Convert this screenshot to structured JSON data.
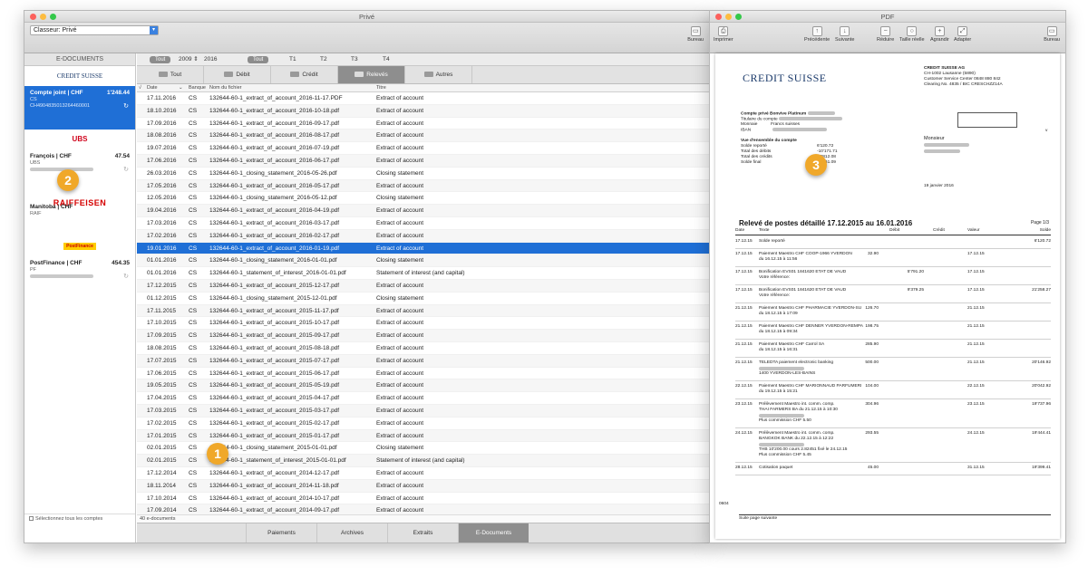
{
  "main_window": {
    "title": "Privé",
    "classeur_select": "Classeur: Privé",
    "bureau_label": "Bureau",
    "sidebar": {
      "header": "E-DOCUMENTS",
      "select_all_label": "Sélectionnez tous les comptes",
      "accounts": [
        {
          "bank_logo": "CREDIT SUISSE",
          "name": "Compte joint | CHF",
          "balance": "1'248.44",
          "bank": "CS",
          "iban": "CH4904835013264460001",
          "selected": true
        },
        {
          "bank_logo": "UBS",
          "name": "François | CHF",
          "balance": "47.54",
          "bank": "UBS",
          "iban": "",
          "selected": false
        },
        {
          "bank_logo": "RAIFFEISEN",
          "name": "Manitoba | CHF",
          "balance": "",
          "bank": "RAIF",
          "iban": "",
          "selected": false
        },
        {
          "bank_logo": "PostFinance",
          "name": "PostFinance | CHF",
          "balance": "454.35",
          "bank": "PF",
          "iban": "",
          "selected": false
        }
      ]
    },
    "filter": {
      "tout1": "Tout",
      "year_from": "2009",
      "year_to": "2016",
      "tout2": "Tout",
      "quarters": [
        "T1",
        "T2",
        "T3",
        "T4"
      ]
    },
    "tabs": [
      "Tout",
      "Débit",
      "Crédit",
      "Relevés",
      "Autres"
    ],
    "active_tab": 3,
    "columns": {
      "date": "Date",
      "bank": "Banque",
      "file": "Nom du fichier",
      "title": "Titre"
    },
    "rows": [
      {
        "date": "17.11.2016",
        "bank": "CS",
        "file": "132644-60-1_extract_of_account_2016-11-17.PDF",
        "title": "Extract of account"
      },
      {
        "date": "18.10.2016",
        "bank": "CS",
        "file": "132644-60-1_extract_of_account_2016-10-18.pdf",
        "title": "Extract of account"
      },
      {
        "date": "17.09.2016",
        "bank": "CS",
        "file": "132644-60-1_extract_of_account_2016-09-17.pdf",
        "title": "Extract of account"
      },
      {
        "date": "18.08.2016",
        "bank": "CS",
        "file": "132644-60-1_extract_of_account_2016-08-17.pdf",
        "title": "Extract of account"
      },
      {
        "date": "19.07.2016",
        "bank": "CS",
        "file": "132644-60-1_extract_of_account_2016-07-19.pdf",
        "title": "Extract of account"
      },
      {
        "date": "17.06.2016",
        "bank": "CS",
        "file": "132644-60-1_extract_of_account_2016-06-17.pdf",
        "title": "Extract of account"
      },
      {
        "date": "26.03.2016",
        "bank": "CS",
        "file": "132644-60-1_closing_statement_2016-05-26.pdf",
        "title": "Closing statement"
      },
      {
        "date": "17.05.2016",
        "bank": "CS",
        "file": "132644-60-1_extract_of_account_2016-05-17.pdf",
        "title": "Extract of account"
      },
      {
        "date": "12.05.2016",
        "bank": "CS",
        "file": "132644-60-1_closing_statement_2016-05-12.pdf",
        "title": "Closing statement"
      },
      {
        "date": "19.04.2016",
        "bank": "CS",
        "file": "132644-60-1_extract_of_account_2016-04-19.pdf",
        "title": "Extract of account"
      },
      {
        "date": "17.03.2016",
        "bank": "CS",
        "file": "132644-60-1_extract_of_account_2016-03-17.pdf",
        "title": "Extract of account"
      },
      {
        "date": "17.02.2016",
        "bank": "CS",
        "file": "132644-60-1_extract_of_account_2016-02-17.pdf",
        "title": "Extract of account"
      },
      {
        "date": "19.01.2016",
        "bank": "CS",
        "file": "132644-60-1_extract_of_account_2016-01-19.pdf",
        "title": "Extract of account",
        "selected": true
      },
      {
        "date": "01.01.2016",
        "bank": "CS",
        "file": "132644-60-1_closing_statement_2016-01-01.pdf",
        "title": "Closing statement"
      },
      {
        "date": "01.01.2016",
        "bank": "CS",
        "file": "132644-60-1_statement_of_interest_2016-01-01.pdf",
        "title": "Statement of interest (and capital)"
      },
      {
        "date": "17.12.2015",
        "bank": "CS",
        "file": "132644-60-1_extract_of_account_2015-12-17.pdf",
        "title": "Extract of account"
      },
      {
        "date": "01.12.2015",
        "bank": "CS",
        "file": "132644-60-1_closing_statement_2015-12-01.pdf",
        "title": "Closing statement"
      },
      {
        "date": "17.11.2015",
        "bank": "CS",
        "file": "132644-60-1_extract_of_account_2015-11-17.pdf",
        "title": "Extract of account"
      },
      {
        "date": "17.10.2015",
        "bank": "CS",
        "file": "132644-60-1_extract_of_account_2015-10-17.pdf",
        "title": "Extract of account"
      },
      {
        "date": "17.09.2015",
        "bank": "CS",
        "file": "132644-60-1_extract_of_account_2015-09-17.pdf",
        "title": "Extract of account"
      },
      {
        "date": "18.08.2015",
        "bank": "CS",
        "file": "132644-60-1_extract_of_account_2015-08-18.pdf",
        "title": "Extract of account"
      },
      {
        "date": "17.07.2015",
        "bank": "CS",
        "file": "132644-60-1_extract_of_account_2015-07-17.pdf",
        "title": "Extract of account"
      },
      {
        "date": "17.06.2015",
        "bank": "CS",
        "file": "132644-60-1_extract_of_account_2015-06-17.pdf",
        "title": "Extract of account"
      },
      {
        "date": "19.05.2015",
        "bank": "CS",
        "file": "132644-60-1_extract_of_account_2015-05-19.pdf",
        "title": "Extract of account"
      },
      {
        "date": "17.04.2015",
        "bank": "CS",
        "file": "132644-60-1_extract_of_account_2015-04-17.pdf",
        "title": "Extract of account"
      },
      {
        "date": "17.03.2015",
        "bank": "CS",
        "file": "132644-60-1_extract_of_account_2015-03-17.pdf",
        "title": "Extract of account"
      },
      {
        "date": "17.02.2015",
        "bank": "CS",
        "file": "132644-60-1_extract_of_account_2015-02-17.pdf",
        "title": "Extract of account"
      },
      {
        "date": "17.01.2015",
        "bank": "CS",
        "file": "132644-60-1_extract_of_account_2015-01-17.pdf",
        "title": "Extract of account"
      },
      {
        "date": "02.01.2015",
        "bank": "CS",
        "file": "132644-60-1_closing_statement_2015-01-01.pdf",
        "title": "Closing statement"
      },
      {
        "date": "02.01.2015",
        "bank": "CS",
        "file": "132644-60-1_statement_of_interest_2015-01-01.pdf",
        "title": "Statement of interest (and capital)"
      },
      {
        "date": "17.12.2014",
        "bank": "CS",
        "file": "132644-60-1_extract_of_account_2014-12-17.pdf",
        "title": "Extract of account"
      },
      {
        "date": "18.11.2014",
        "bank": "CS",
        "file": "132644-60-1_extract_of_account_2014-11-18.pdf",
        "title": "Extract of account"
      },
      {
        "date": "17.10.2014",
        "bank": "CS",
        "file": "132644-60-1_extract_of_account_2014-10-17.pdf",
        "title": "Extract of account"
      },
      {
        "date": "17.09.2014",
        "bank": "CS",
        "file": "132644-60-1_extract_of_account_2014-09-17.pdf",
        "title": "Extract of account"
      }
    ],
    "doc_count": "40 e-documents",
    "bottom_tabs": [
      "Paiements",
      "Archives",
      "Extraits",
      "E-Documents"
    ],
    "active_bottom_tab": 3
  },
  "badges": [
    "1",
    "2",
    "3"
  ],
  "pdf_window": {
    "title": "PDF",
    "toolbar": {
      "print": "Imprimer",
      "prev": "Précédente",
      "next": "Suivante",
      "zoom_out": "Réduire",
      "actual_size": "Taille réelle",
      "zoom_in": "Agrandir",
      "fit": "Adapter",
      "bureau": "Bureau"
    },
    "doc": {
      "logo": "CREDIT SUISSE",
      "bank_name": "CREDIT SUISSE AG",
      "bank_addr1": "CH-1002 Lausanne (5890)",
      "bank_addr2": "Customer Service Center 0848 880 842",
      "bank_addr3": "Clearing No. 4835 / BIC CRESCHZZ14A",
      "account_title": "Compte privé Bonvive Platinum",
      "holder_label": "Titulaire du compte",
      "currency_label": "Monnaie",
      "currency_value": "Francs suisses",
      "iban_label": "IBAN",
      "overview_title": "Vue d'ensemble du compte",
      "summary": [
        {
          "label": "Solde reporté",
          "value": "6'120.72"
        },
        {
          "label": "Total des débits",
          "value": "-10'171.71"
        },
        {
          "label": "Total des crédits",
          "value": "14'812.08"
        },
        {
          "label": "Solde final",
          "value": "10'761.09"
        }
      ],
      "salutation": "Monsieur",
      "date": "19 janvier 2016",
      "statement_title": "Relevé de postes détaillé 17.12.2015 au 16.01.2016",
      "page": "Page 1/3",
      "cols": {
        "date": "Date",
        "text": "Texte",
        "debit": "Débit",
        "credit": "Crédit",
        "value": "Valeur",
        "balance": "Solde"
      },
      "transactions": [
        {
          "date": "17.12.15",
          "text": [
            "Solde reporté"
          ],
          "debit": "",
          "credit": "",
          "value": "",
          "balance": "6'120.72"
        },
        {
          "date": "17.12.15",
          "text": [
            "Paiement Maestro CHF COOP-1966 YVERDON",
            "du 16.12.15 à 11:56"
          ],
          "debit": "32.90",
          "credit": "",
          "value": "17.12.15",
          "balance": ""
        },
        {
          "date": "17.12.15",
          "text": [
            "Bonification EVS01 1841620 ETAT DE VAUD",
            "Votre référence:"
          ],
          "debit": "",
          "credit": "5'791.20",
          "value": "17.12.15",
          "balance": ""
        },
        {
          "date": "17.12.15",
          "text": [
            "Bonification EVS01 1841620 ETAT DE VAUD",
            "Votre référence:"
          ],
          "debit": "",
          "credit": "9'379.25",
          "value": "17.12.15",
          "balance": "21'258.27"
        },
        {
          "date": "21.12.15",
          "text": [
            "Paiement Maestro CHF PHARMACIE YVERDON-SU",
            "du 18.12.15 à 17:09"
          ],
          "debit": "126.70",
          "credit": "",
          "value": "21.12.15",
          "balance": ""
        },
        {
          "date": "21.12.15",
          "text": [
            "Paiement Maestro CHF DENNER YVERDON-REMPA",
            "du 18.12.15 à 09:34"
          ],
          "debit": "198.75",
          "credit": "",
          "value": "21.12.15",
          "balance": ""
        },
        {
          "date": "21.12.15",
          "text": [
            "Paiement Maestro CHF Carrol SA",
            "du 18.12.15 à 16:31"
          ],
          "debit": "285.90",
          "credit": "",
          "value": "21.12.15",
          "balance": ""
        },
        {
          "date": "21.12.15",
          "text": [
            "TELEDTA paiement electronic banking",
            "",
            "1400 YVERDON-LES-BAINS"
          ],
          "debit": "500.00",
          "credit": "",
          "value": "21.12.15",
          "balance": "20'146.92"
        },
        {
          "date": "22.12.15",
          "text": [
            "Paiement Maestro CHF MARIONNAUD PARFUMERI",
            "du 19.12.15 à 15:21"
          ],
          "debit": "104.00",
          "credit": "",
          "value": "22.12.15",
          "balance": "20'042.92"
        },
        {
          "date": "23.12.15",
          "text": [
            "Prélèvement Maestro int. comm. comp.",
            "THAI FARMERS BA du 21.12.15 à 10:30",
            "",
            "Plus commission CHF 5.50"
          ],
          "debit": "304.96",
          "credit": "",
          "value": "23.12.15",
          "balance": "19'737.96"
        },
        {
          "date": "24.12.15",
          "text": [
            "Prélèvement Maestro int. comm. comp.",
            "BANGKOK BANK du 22.12.15 à 12:22",
            "",
            "THB 10'200.00 cours 2.82451 fixé le 24.12.15",
            "Plus commission CHF 5.45"
          ],
          "debit": "293.55",
          "credit": "",
          "value": "24.12.15",
          "balance": "19'444.41"
        },
        {
          "date": "28.12.15",
          "text": [
            "Cotisation paquet"
          ],
          "debit": "45.00",
          "credit": "",
          "value": "31.12.15",
          "balance": "19'399.41"
        }
      ],
      "footer": "Suite page suivante",
      "side_code": "0604"
    }
  }
}
